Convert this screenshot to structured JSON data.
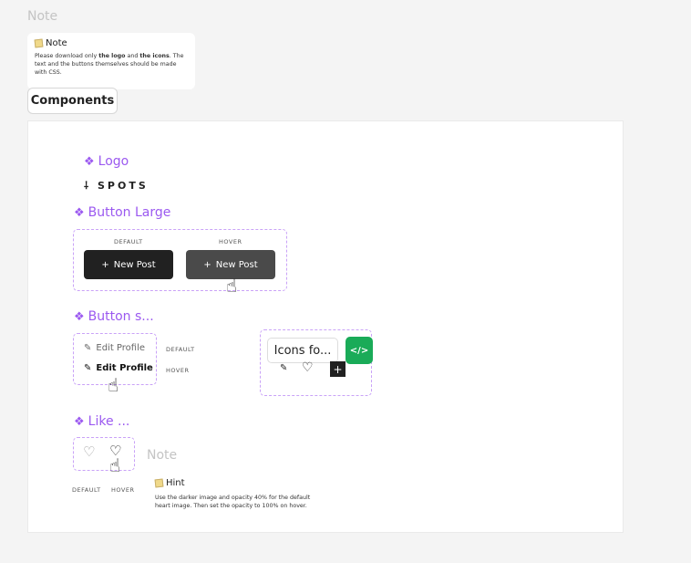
{
  "top_note_label": "Note",
  "note": {
    "title": "Note",
    "body_prefix": "Please download only ",
    "bold1": "the logo",
    "middle": " and ",
    "bold2": "the icons",
    "suffix": ". The text and the buttons themselves should be made with CSS."
  },
  "components_button": "Components",
  "sections": {
    "logo": "Logo",
    "button_large": "Button Large",
    "button_small": "Button s...",
    "like": "Like ..."
  },
  "logo_text": "SPOTS",
  "button_large": {
    "default_label": "DEFAULT",
    "hover_label": "HOVER",
    "text": "New Post",
    "default_color": "#212121",
    "hover_color": "#4a4a4a"
  },
  "button_small": {
    "text": "Edit Profile",
    "default_label": "DEFAULT",
    "hover_label": "HOVER"
  },
  "icons_panel": {
    "title": "Icons fo...",
    "code_button": "</>",
    "code_color": "#1aab58"
  },
  "like": {
    "default_label": "DEFAULT",
    "hover_label": "HOVER"
  },
  "hint": {
    "note_label": "Note",
    "title": "Hint",
    "body": "Use the darker image and opacity 40% for the default heart image. Then set the opacity to 100% on hover."
  },
  "accent_color": "#9b59f0"
}
